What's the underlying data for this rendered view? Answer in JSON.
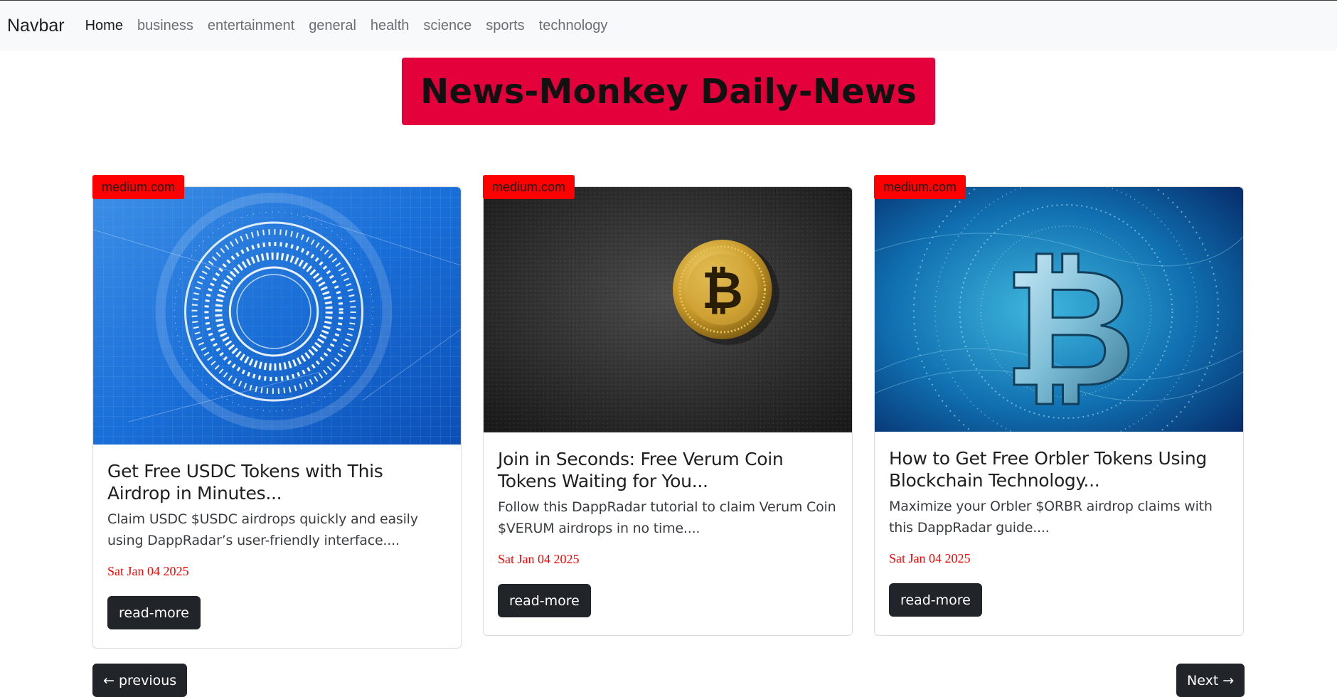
{
  "navbar": {
    "brand": "Navbar",
    "links": [
      {
        "label": "Home",
        "active": true
      },
      {
        "label": "business"
      },
      {
        "label": "entertainment"
      },
      {
        "label": "general"
      },
      {
        "label": "health"
      },
      {
        "label": "science"
      },
      {
        "label": "sports"
      },
      {
        "label": "technology"
      }
    ]
  },
  "header": {
    "title": "News-Monkey Daily-News",
    "background": "#e4003a"
  },
  "articles": [
    {
      "source": "medium.com",
      "image": "blue-digital-circle-image",
      "title": "Get Free USDC Tokens with This Airdrop in Minutes...",
      "description": "Claim USDC $USDC airdrops quickly and easily using DappRadar’s user-friendly interface....",
      "date": "Sat Jan 04 2025",
      "button": "read-more"
    },
    {
      "source": "medium.com",
      "image": "gold-bitcoin-on-black-image",
      "title": "Join in Seconds: Free Verum Coin Tokens Waiting for You...",
      "description": "Follow this DappRadar tutorial to claim Verum Coin $VERUM airdrops in no time....",
      "date": "Sat Jan 04 2025",
      "button": "read-more"
    },
    {
      "source": "medium.com",
      "image": "blue-bitcoin-symbol-image",
      "title": "How to Get Free Orbler Tokens Using Blockchain Technology...",
      "description": "Maximize your Orbler $ORBR airdrop claims with this DappRadar guide....",
      "date": "Sat Jan 04 2025",
      "button": "read-more"
    }
  ],
  "pagination": {
    "previous": "← previous",
    "next": "Next →"
  },
  "colors": {
    "badge": "#ff0000",
    "date": "#ff0000",
    "button": "#212529"
  }
}
